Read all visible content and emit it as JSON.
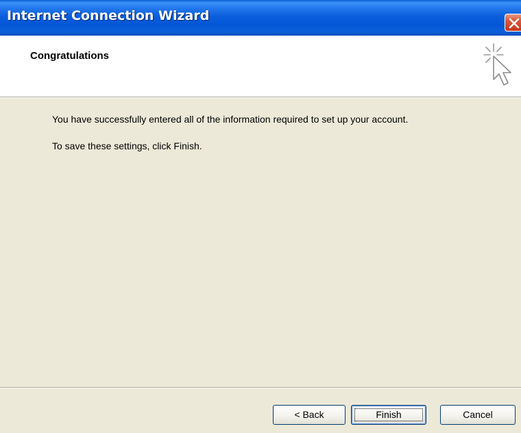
{
  "window": {
    "title": "Internet Connection Wizard"
  },
  "header": {
    "heading": "Congratulations",
    "icon": "wizard-cursor-sparkle-icon"
  },
  "body": {
    "line1": "You have successfully entered all of the information required to set up your account.",
    "line2": "To save these settings, click Finish."
  },
  "buttons": {
    "back_label": "< Back",
    "finish_label": "Finish",
    "cancel_label": "Cancel"
  },
  "colors": {
    "titlebar": "#0a5fd8",
    "close_button": "#db5a3a",
    "dialog_background": "#ece9d8",
    "header_background": "#ffffff"
  }
}
